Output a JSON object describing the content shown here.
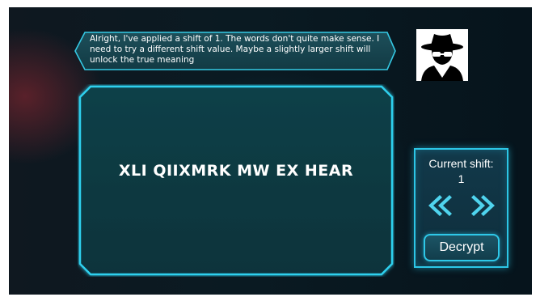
{
  "dialogue": {
    "text": "Alright, I've applied a shift of 1. The words don't quite make sense. I need to try a different shift value. Maybe a slightly larger shift will unlock the true meaning"
  },
  "avatar": {
    "icon": "spy-icon"
  },
  "cipher": {
    "text": "XLI QIIXMRK MW EX HEAR"
  },
  "shift_panel": {
    "label": "Current shift:",
    "value": "1",
    "decrypt_label": "Decrypt",
    "left_icon": "double-chevron-left-icon",
    "right_icon": "double-chevron-right-icon"
  },
  "colors": {
    "accent": "#2cc6e6",
    "panel": "#0f3d45",
    "background": "#0a1a22"
  }
}
